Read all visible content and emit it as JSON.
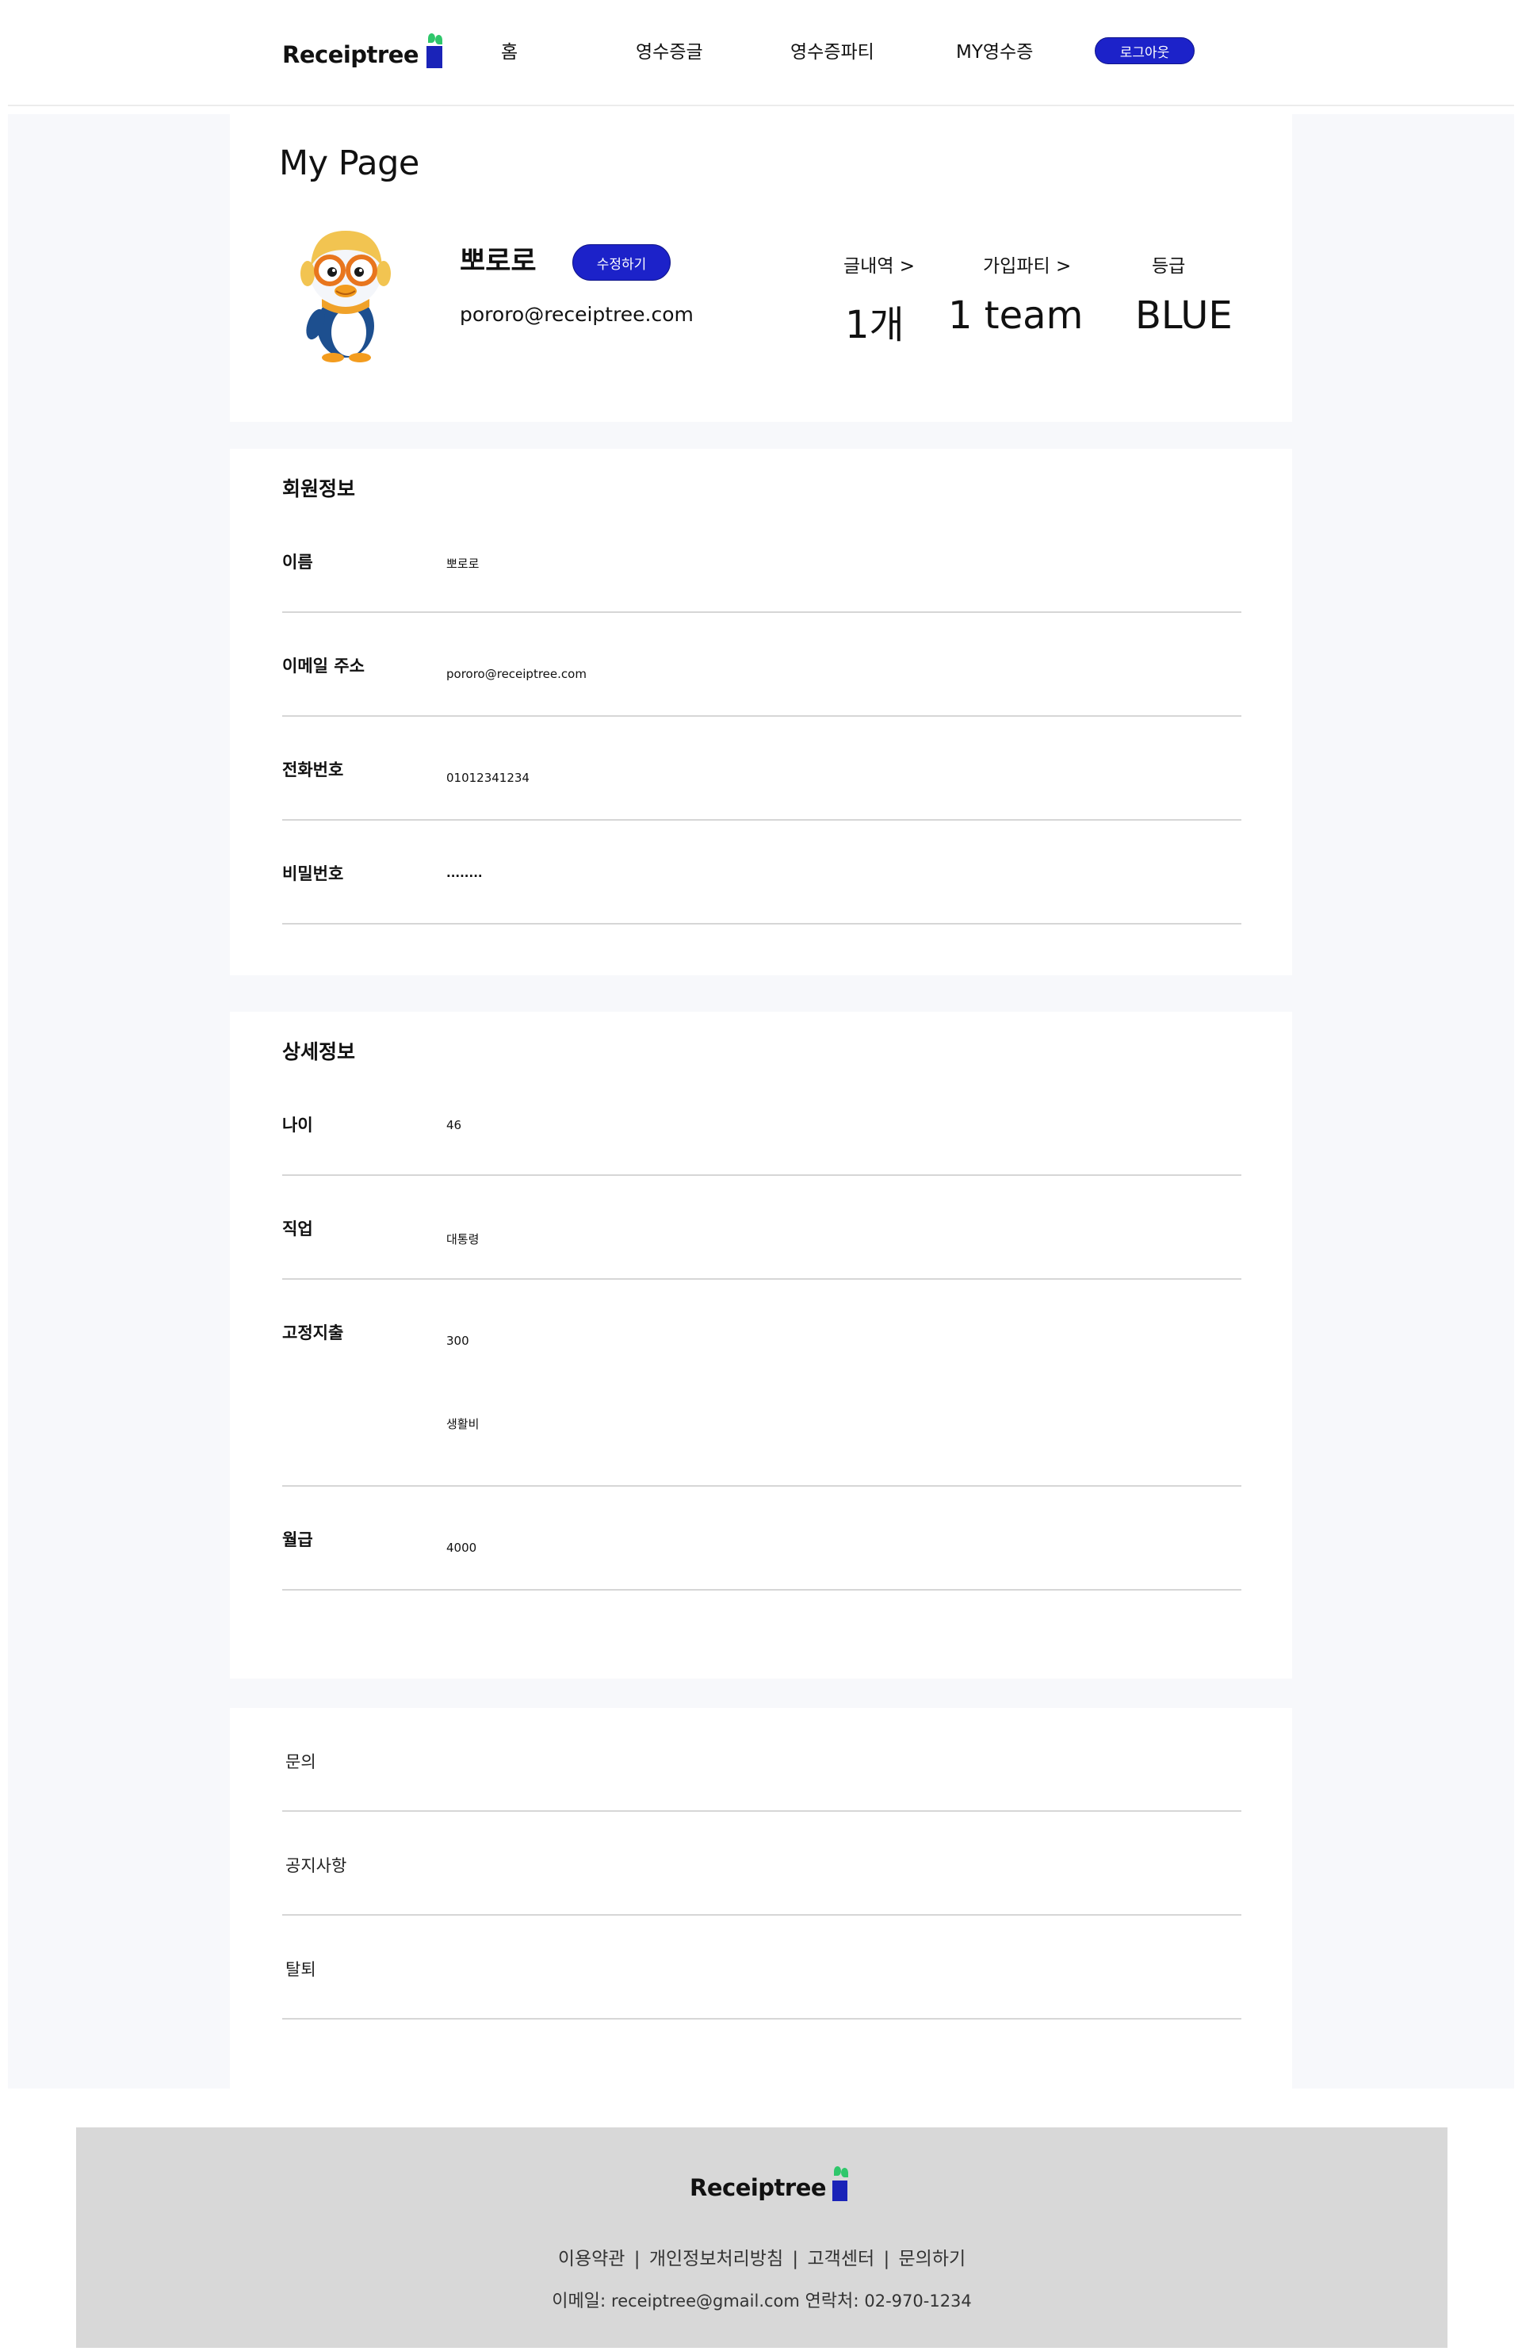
{
  "header": {
    "logo": "Receiptree",
    "nav": [
      "홈",
      "영수증글",
      "영수증파티",
      "MY영수증"
    ],
    "logout_label": "로그아웃"
  },
  "profile": {
    "page_title": "My Page",
    "name": "뽀로로",
    "edit_label": "수정하기",
    "email": "pororo@receiptree.com",
    "stats": [
      {
        "label": "글내역 >",
        "value": "1개"
      },
      {
        "label": "가입파티 >",
        "value": "1 team"
      },
      {
        "label": "등급",
        "value": "BLUE"
      }
    ]
  },
  "member_info": {
    "title": "회원정보",
    "rows": [
      {
        "label": "이름",
        "value": "뽀로로"
      },
      {
        "label": "이메일 주소",
        "value": "pororo@receiptree.com"
      },
      {
        "label": "전화번호",
        "value": "01012341234"
      },
      {
        "label": "비밀번호",
        "value": "........"
      }
    ]
  },
  "detail_info": {
    "title": "상세정보",
    "age": {
      "label": "나이",
      "value": "46"
    },
    "job": {
      "label": "직업",
      "value": "대통령"
    },
    "fixed_expense": {
      "label": "고정지출",
      "value": "300",
      "category": "생활비"
    },
    "salary": {
      "label": "월급",
      "value": "4000"
    }
  },
  "links": [
    {
      "label": "문의"
    },
    {
      "label": "공지사항"
    },
    {
      "label": "탈퇴"
    }
  ],
  "footer": {
    "logo": "Receiptree",
    "links": [
      "이용약관",
      "개인정보처리방침",
      "고객센터",
      "문의하기"
    ],
    "email_label": "이메일:",
    "email": "receiptree@gmail.com",
    "phone_label": "연락처:",
    "phone": "02-970-1234"
  },
  "colors": {
    "accent": "#1c22c9",
    "logo_leaf": "#2fc76b",
    "page_bg": "#f7f8fb",
    "footer_bg": "#d8d8d8"
  }
}
